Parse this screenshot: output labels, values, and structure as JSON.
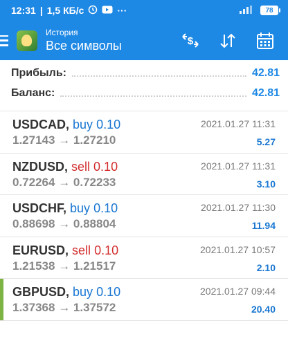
{
  "status_bar": {
    "time": "12:31",
    "speed": "1,5 КБ/с",
    "battery": "78"
  },
  "toolbar": {
    "subtitle": "История",
    "title": "Все символы"
  },
  "summary": {
    "profit_label": "Прибыль:",
    "profit_value": "42.81",
    "balance_label": "Баланс:",
    "balance_value": "42.81"
  },
  "deals": [
    {
      "symbol": "USDCAD",
      "type": "buy",
      "volume": "0.10",
      "open": "1.27143",
      "close": "1.27210",
      "time": "2021.01.27 11:31",
      "profit": "5.27"
    },
    {
      "symbol": "NZDUSD",
      "type": "sell",
      "volume": "0.10",
      "open": "0.72264",
      "close": "0.72233",
      "time": "2021.01.27 11:31",
      "profit": "3.10"
    },
    {
      "symbol": "USDCHF",
      "type": "buy",
      "volume": "0.10",
      "open": "0.88698",
      "close": "0.88804",
      "time": "2021.01.27 11:30",
      "profit": "11.94"
    },
    {
      "symbol": "EURUSD",
      "type": "sell",
      "volume": "0.10",
      "open": "1.21538",
      "close": "1.21517",
      "time": "2021.01.27 10:57",
      "profit": "2.10"
    },
    {
      "symbol": "GBPUSD",
      "type": "buy",
      "volume": "0.10",
      "open": "1.37368",
      "close": "1.37572",
      "time": "2021.01.27 09:44",
      "profit": "20.40"
    }
  ],
  "colors": {
    "appbar": "#1e88e5",
    "buy": "#1976d2",
    "sell": "#d32f2f",
    "selected_marker": "#7cb342"
  },
  "icons": [
    "menu-icon",
    "app-logo-icon",
    "currency-exchange-icon",
    "sort-icon",
    "calendar-icon",
    "clock-icon",
    "messenger-icon"
  ]
}
